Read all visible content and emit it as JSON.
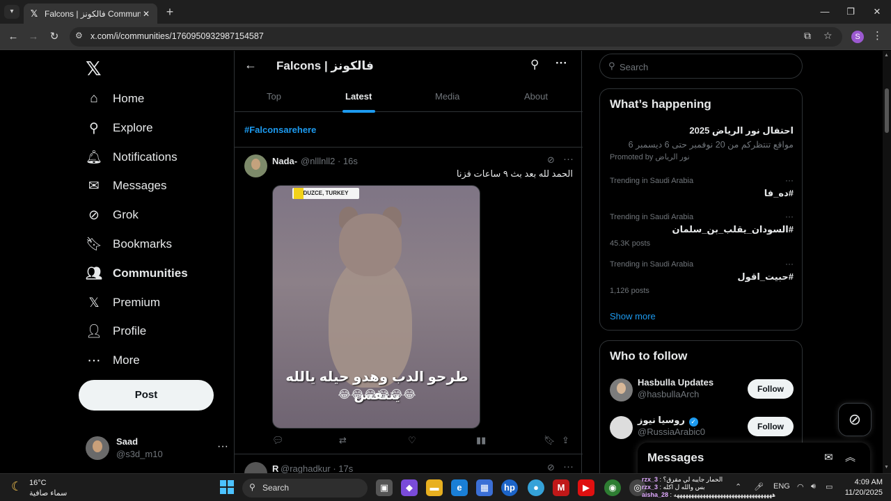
{
  "browser": {
    "tab_title": "Falcons | فالكونز Community / X",
    "url": "x.com/i/communities/1760950932987154587",
    "profile_initial": "S"
  },
  "nav": {
    "items": [
      {
        "label": "Home",
        "icon": "home-icon"
      },
      {
        "label": "Explore",
        "icon": "search-icon"
      },
      {
        "label": "Notifications",
        "icon": "bell-icon"
      },
      {
        "label": "Messages",
        "icon": "envelope-icon"
      },
      {
        "label": "Grok",
        "icon": "grok-icon"
      },
      {
        "label": "Bookmarks",
        "icon": "bookmark-icon"
      },
      {
        "label": "Communities",
        "icon": "people-icon"
      },
      {
        "label": "Premium",
        "icon": "x-icon"
      },
      {
        "label": "Profile",
        "icon": "person-icon"
      },
      {
        "label": "More",
        "icon": "more-circle-icon"
      }
    ],
    "post_label": "Post",
    "me": {
      "name": "Saad",
      "handle": "@s3d_m10"
    }
  },
  "community": {
    "title": "Falcons | فالكونز",
    "tabs": [
      "Top",
      "Latest",
      "Media",
      "About"
    ],
    "active_tab": "Latest",
    "hashtag": "#Falconsarehere"
  },
  "tweet": {
    "name": "Nada-",
    "meta": "@nlllnll2 · 16s",
    "text": "الحمد لله بعد بث ٩ ساعات فزنا",
    "media": {
      "location_tag": "DUZCE, TURKEY",
      "caption": "طرحو الدب وهدو حيله يالله يتنفس",
      "emoji": "😂😂😂😂😂😂"
    }
  },
  "tweet2": {
    "name": "R",
    "meta": "@raghadkur · 17s"
  },
  "search": {
    "placeholder": "Search"
  },
  "trends": {
    "title": "What’s happening",
    "promo": {
      "title": "احتفال نور الرياض 2025",
      "desc": "مواقع تنتظركم من 20 نوفمبر حتى 6 ديسمبر 6",
      "by": "Promoted by نور الرياض"
    },
    "items": [
      {
        "context": "Trending in Saudi Arabia",
        "name": "#ده_فا",
        "count": ""
      },
      {
        "context": "Trending in Saudi Arabia",
        "name": "#السودان_يقلب_بن_سلمان",
        "count": "45.3K posts"
      },
      {
        "context": "Trending in Saudi Arabia",
        "name": "#حبيت_اقول",
        "count": "1,126 posts"
      }
    ],
    "show_more": "Show more"
  },
  "who_to_follow": {
    "title": "Who to follow",
    "items": [
      {
        "name": "Hasbulla Updates",
        "handle": "@hasbullaArch",
        "button": "Follow"
      },
      {
        "name": "روسيا نيوز",
        "handle": "@RussiaArabic0",
        "button": "Follow"
      }
    ]
  },
  "messages_drawer": {
    "title": "Messages"
  },
  "taskbar": {
    "temp": "16°C",
    "condition": "سماء صافية",
    "search_label": "Search",
    "lang": "ENG",
    "time": "4:09 AM",
    "date": "11/20/2025",
    "notif_lines": [
      {
        "user": "rzx_3",
        "text": "الحمار جايبه لي مقرق؟"
      },
      {
        "user": "rzx_3",
        "text": "بس والله ل اكله"
      },
      {
        "user": "aisha_28",
        "text": "ههههههههههههههههههههههههههههههههههه"
      }
    ]
  }
}
